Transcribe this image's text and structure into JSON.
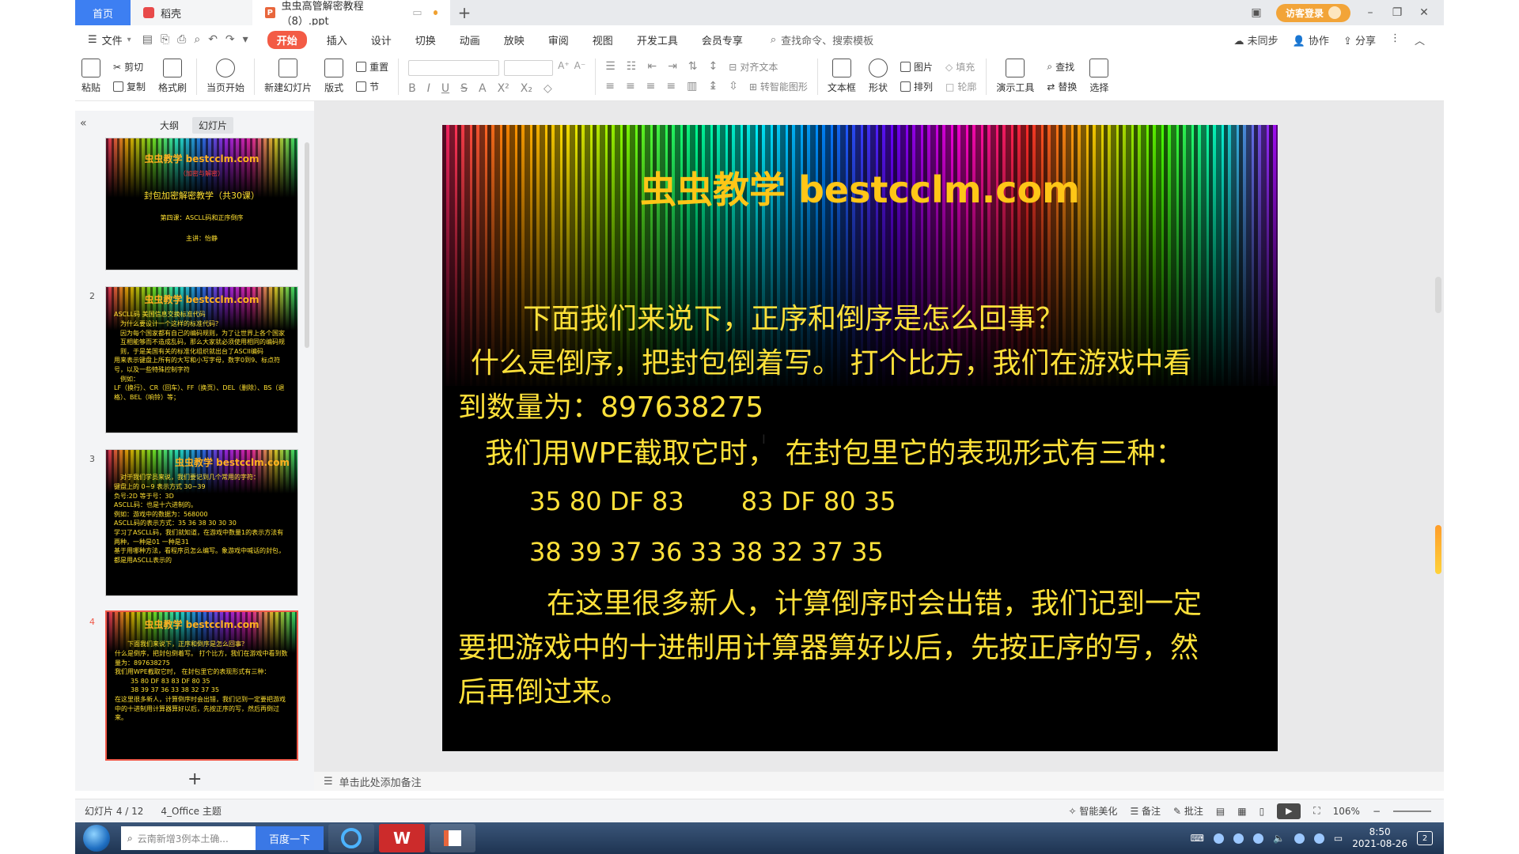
{
  "tabs": {
    "home": "首页",
    "shell": "稻壳",
    "document": "虫虫高管解密教程（8）.ppt",
    "login": "访客登录"
  },
  "menu": {
    "file": "文件",
    "items": [
      "开始",
      "插入",
      "设计",
      "切换",
      "动画",
      "放映",
      "审阅",
      "视图",
      "开发工具",
      "会员专享"
    ],
    "search": "查找命令、搜索模板",
    "sync": "未同步",
    "collab": "协作",
    "share": "分享"
  },
  "ribbon": {
    "paste": "粘贴",
    "cut": "剪切",
    "copy": "复制",
    "format_painter": "格式刷",
    "play_from_current": "当页开始",
    "new_slide": "新建幻灯片",
    "layout": "版式",
    "section": "节",
    "reset": "重置",
    "align_text": "对齐文本",
    "smartart": "转智能图形",
    "textbox": "文本框",
    "shape": "形状",
    "picture": "图片",
    "arrange": "排列",
    "fill": "填充",
    "outline": "轮廓",
    "present_tools": "演示工具",
    "find": "查找",
    "replace": "替换",
    "select": "选择"
  },
  "sidebar": {
    "outline_tab": "大纲",
    "slides_tab": "幻灯片",
    "thumbs": [
      {
        "num": "",
        "title": "虫虫教学 bestcclm.com",
        "lines": [
          "（加密与解密）",
          "封包加密解密教学（共30课）",
          "第四课：ASCLL码和正序倒序",
          "主讲：怡静"
        ]
      },
      {
        "num": "2",
        "title": "虫虫教学 bestcclm.com",
        "lines": [
          "ASCLL码  美国信息交换标准代码",
          "为什么要设计一个这样的标准代码？",
          "因为每个国家都有自己的编码规则，为了让世界上各个国家互相能够而不造成乱码，那么大家就必须使用相同的编码规则，于是美国有关的标准化组织就出台了ASCII编码",
          "用来表示键盘上所有的大写和小写字母，数字0到9、标点符号，以及一些特殊控制字符",
          "例如：",
          "LF（换行）、CR（回车）、FF（换页）、DEL（删除）、BS（退格）、BEL（响铃）等；"
        ]
      },
      {
        "num": "3",
        "title": "虫虫教学 bestcclm.com",
        "lines": [
          "对于我们学员来说，我们要记到几个常用的字符：",
          "键盘上的 0~9  表示方式   30~39",
          "负号:2D   等于号：3D",
          "ASCLL码：也是十六进制的。",
          "例如：游戏中的数据为：568000",
          "ASCLL码的表示方式：35 36 38 30 30 30",
          "学习了ASCLL码，我们就知道，在游戏中数量1的表示方法有两种，一种是01  一种是31",
          "基于用哪种方法，看程序员怎么编写。象游戏中喊话的封包，都是用ASCLL表示的"
        ]
      },
      {
        "num": "4",
        "title": "虫虫教学 bestcclm.com",
        "lines": [
          "下面我们来说下，正序和倒序是怎么回事？",
          "什么是倒序，把封包倒着写。 打个比方，我们在游戏中看到数量为：897638275",
          "我们用WPE截取它时， 在封包里它的表现形式有三种：",
          "35 80 DF 83      83 DF 80 35",
          "38 39 37 36 33 38 32 37 35",
          "在这里很多新人，计算倒序时会出错，我们记到一定要把游戏中的十进制用计算器算好以后，先按正序的写，然后再倒过来。"
        ]
      }
    ]
  },
  "slide": {
    "title": "虫虫教学  bestcclm.com",
    "line1": "下面我们来说下，正序和倒序是怎么回事？",
    "line2a": "什么是倒序，把封包倒着写。  打个比方，我们在游戏中看",
    "line2b": "到数量为：897638275",
    "line3": "我们用WPE截取它时，  在封包里它的表现形式有三种：",
    "code1a": "35 80 DF 83",
    "code1b": "83 DF 80 35",
    "code2": "38 39 37 36 33 38 32 37 35",
    "line4a": "在这里很多新人，计算倒序时会出错，我们记到一定",
    "line4b": "要把游戏中的十进制用计算器算好以后，先按正序的写，然",
    "line4c": "后再倒过来。"
  },
  "notes": {
    "placeholder": "单击此处添加备注"
  },
  "status": {
    "slide_count": "幻灯片 4 / 12",
    "theme": "4_Office 主题",
    "beautify": "智能美化",
    "notes": "备注",
    "comments": "批注",
    "zoom": "106%"
  },
  "taskbar": {
    "search_placeholder": "云南新增3例本土确...",
    "search_button": "百度一下",
    "time": "8:50",
    "date": "2021-08-26",
    "notif_count": "2"
  }
}
